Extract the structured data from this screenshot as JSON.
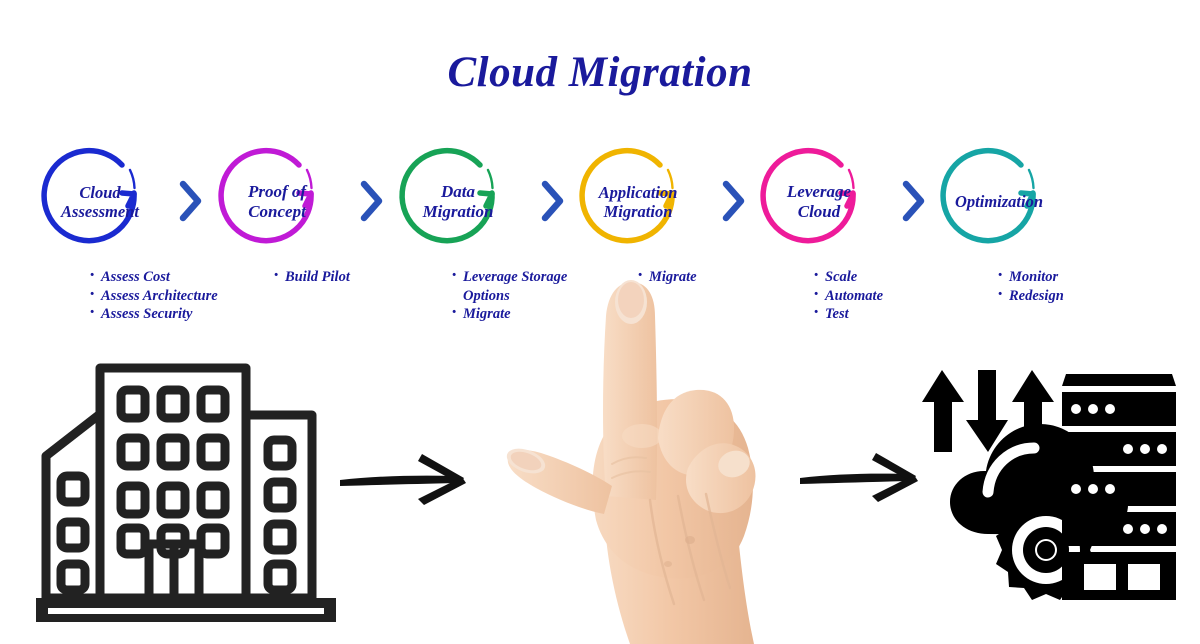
{
  "title": "Cloud Migration",
  "colors": {
    "title_blue": "#1a1a9c",
    "text_blue": "#1a1a9c",
    "chevron_blue": "#2a52b8",
    "stage_1": "#1a2ad0",
    "stage_2": "#c01ad6",
    "stage_3": "#17a356",
    "stage_4": "#f0b400",
    "stage_5": "#ee1b9a",
    "stage_6": "#16a5a5",
    "artwork_black": "#1f1f1f",
    "skin": "#f2c9a8",
    "background": "#ffffff"
  },
  "stages": [
    {
      "id": "cloud-assessment",
      "label": "Cloud\nAssessment",
      "label_line1": "Cloud",
      "label_line2": "Assessment",
      "color": "#1a2ad0",
      "bullets": [
        "Assess Cost",
        "Assess Architecture",
        "Assess Security"
      ]
    },
    {
      "id": "proof-of-concept",
      "label": "Proof of\nConcept",
      "label_line1": "Proof of",
      "label_line2": "Concept",
      "color": "#c01ad6",
      "bullets": [
        "Build Pilot"
      ]
    },
    {
      "id": "data-migration",
      "label": "Data\nMigration",
      "label_line1": "Data",
      "label_line2": "Migration",
      "color": "#17a356",
      "bullets": [
        "Leverage Storage Options",
        "Migrate"
      ]
    },
    {
      "id": "application-migration",
      "label": "Application\nMigration",
      "label_line1": "Application",
      "label_line2": "Migration",
      "color": "#f0b400",
      "bullets": [
        "Migrate"
      ]
    },
    {
      "id": "leverage-cloud",
      "label": "Leverage\nCloud",
      "label_line1": "Leverage",
      "label_line2": "Cloud",
      "color": "#ee1b9a",
      "bullets": [
        "Scale",
        "Automate",
        "Test"
      ]
    },
    {
      "id": "optimization",
      "label": "Optimization",
      "label_line1": "Optimization",
      "label_line2": "",
      "color": "#16a5a5",
      "bullets": [
        "Monitor",
        "Redesign"
      ]
    }
  ],
  "separators": [
    "chevron-right-icon",
    "chevron-right-icon",
    "chevron-right-icon",
    "chevron-right-icon",
    "chevron-right-icon"
  ],
  "artwork": {
    "source_icon": "office-building-icon",
    "arrow_1": "arrow-right-icon",
    "pointing_hand": "pointing-hand-icon",
    "arrow_2": "arrow-right-icon",
    "target_icon": "cloud-server-transfer-icon"
  }
}
